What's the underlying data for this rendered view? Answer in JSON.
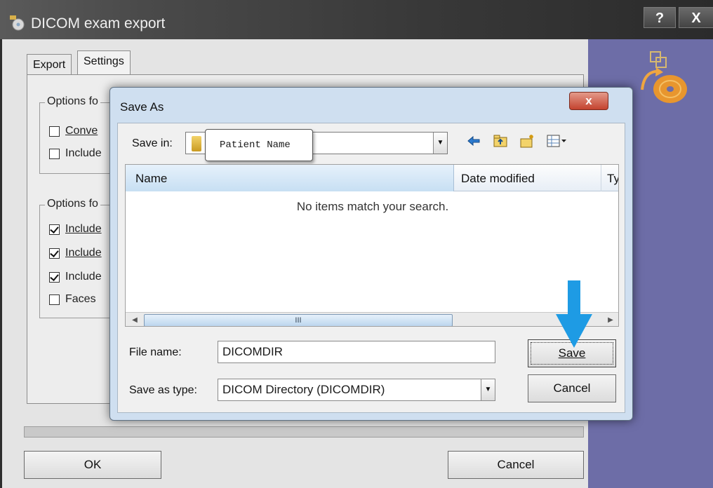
{
  "window": {
    "title": "DICOM exam export",
    "help_button": "?",
    "close_button": "X"
  },
  "tabs": [
    {
      "label": "Export",
      "selected": false
    },
    {
      "label": "Settings",
      "selected": true
    }
  ],
  "settings": {
    "group1": {
      "legend": "Options fo",
      "options": [
        {
          "label": "Conve",
          "checked": false
        },
        {
          "label": "Include",
          "checked": false
        }
      ]
    },
    "group2": {
      "legend": "Options fo",
      "options": [
        {
          "label": "Include",
          "checked": true
        },
        {
          "label": "Include",
          "checked": true
        },
        {
          "label": "Include",
          "checked": true
        },
        {
          "label": "Faces",
          "checked": false
        }
      ]
    }
  },
  "buttons": {
    "ok": "OK",
    "cancel": "Cancel"
  },
  "save_dialog": {
    "title": "Save As",
    "close_button": "x",
    "save_in_label": "Save in:",
    "save_in_value": "",
    "tooltip": "Patient Name",
    "nav_icons": [
      "back-arrow-icon",
      "up-folder-icon",
      "new-folder-icon",
      "view-menu-icon"
    ],
    "columns": [
      "Name",
      "Date modified",
      "Ty"
    ],
    "empty_message": "No items match your search.",
    "scroll_thumb": "III",
    "file_name_label": "File name:",
    "file_name_value": "DICOMDIR",
    "save_type_label": "Save as type:",
    "save_type_value": "DICOM Directory (DICOMDIR)",
    "save_button": "Save",
    "cancel_button": "Cancel"
  },
  "colors": {
    "accent_arrow": "#1e9be4",
    "side_panel": "#6d6da7",
    "close_button": "#c4432f"
  }
}
